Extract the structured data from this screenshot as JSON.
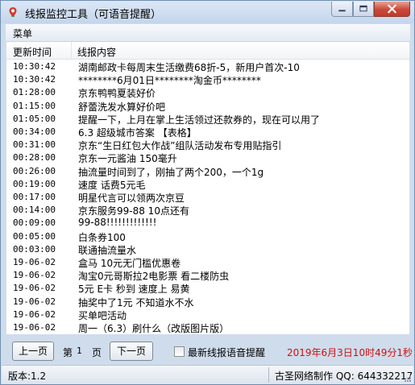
{
  "window": {
    "title": "线报监控工具（可语音提醒）"
  },
  "menu": {
    "items": [
      "菜单"
    ]
  },
  "list": {
    "columns": [
      "更新时间",
      "线报内容"
    ],
    "rows": [
      {
        "time": "10:30:42",
        "content": "湖南邮政卡每周末生活缴费68折-5，新用户首次-10"
      },
      {
        "time": "10:30:42",
        "content": "********6月01日********淘金币********"
      },
      {
        "time": "01:28:00",
        "content": "京东鸭鸭夏装好价"
      },
      {
        "time": "01:15:00",
        "content": "舒蕾洗发水算好价吧"
      },
      {
        "time": "01:05:00",
        "content": "提醒一下，上月在掌上生活领过还款券的，现在可以用了"
      },
      {
        "time": "00:34:00",
        "content": "6.3 超级城市答案 【表格】"
      },
      {
        "time": "00:31:00",
        "content": "京东“生日红包大作战”组队活动发布专用贴指引"
      },
      {
        "time": "00:28:00",
        "content": "京东一元酱油 150毫升"
      },
      {
        "time": "00:26:00",
        "content": "抽流量时间到了，刚抽了两个200，一个1g"
      },
      {
        "time": "00:19:00",
        "content": "速度 话费5元毛"
      },
      {
        "time": "00:17:00",
        "content": "明星代言可以领两次京豆"
      },
      {
        "time": "00:14:00",
        "content": "京东服务99-88 10点还有"
      },
      {
        "time": "00:09:00",
        "content": "99-88!!!!!!!!!!!!!"
      },
      {
        "time": "00:05:00",
        "content": "白条券100"
      },
      {
        "time": "00:03:00",
        "content": "联通抽流量水"
      },
      {
        "time": "19-06-02",
        "content": "盒马 10元无门槛优惠卷"
      },
      {
        "time": "19-06-02",
        "content": "淘宝0元哥斯拉2电影票 看二楼防虫"
      },
      {
        "time": "19-06-02",
        "content": "5元 E卡 秒到 速度上 易黄"
      },
      {
        "time": "19-06-02",
        "content": "抽奖中了1元 不知道水不水"
      },
      {
        "time": "19-06-02",
        "content": "买单吧活动"
      },
      {
        "time": "19-06-02",
        "content": "周一（6.3）刷什么（改版图片版）"
      }
    ]
  },
  "controls": {
    "prev_label": "上一页",
    "page_prefix": "第",
    "page_number": "1",
    "page_suffix": "页",
    "next_label": "下一页",
    "voice_checkbox_label": "最新线报语音提醒",
    "voice_checked": false,
    "datetime": "2019年6月3日10时49分1秒"
  },
  "status": {
    "version": "版本:1.2",
    "credit": "古圣网络制作 QQ: 644332217"
  },
  "colors": {
    "frame": "#cfdcec",
    "close_button": "#c9483a",
    "datetime_text": "#cc1111"
  }
}
